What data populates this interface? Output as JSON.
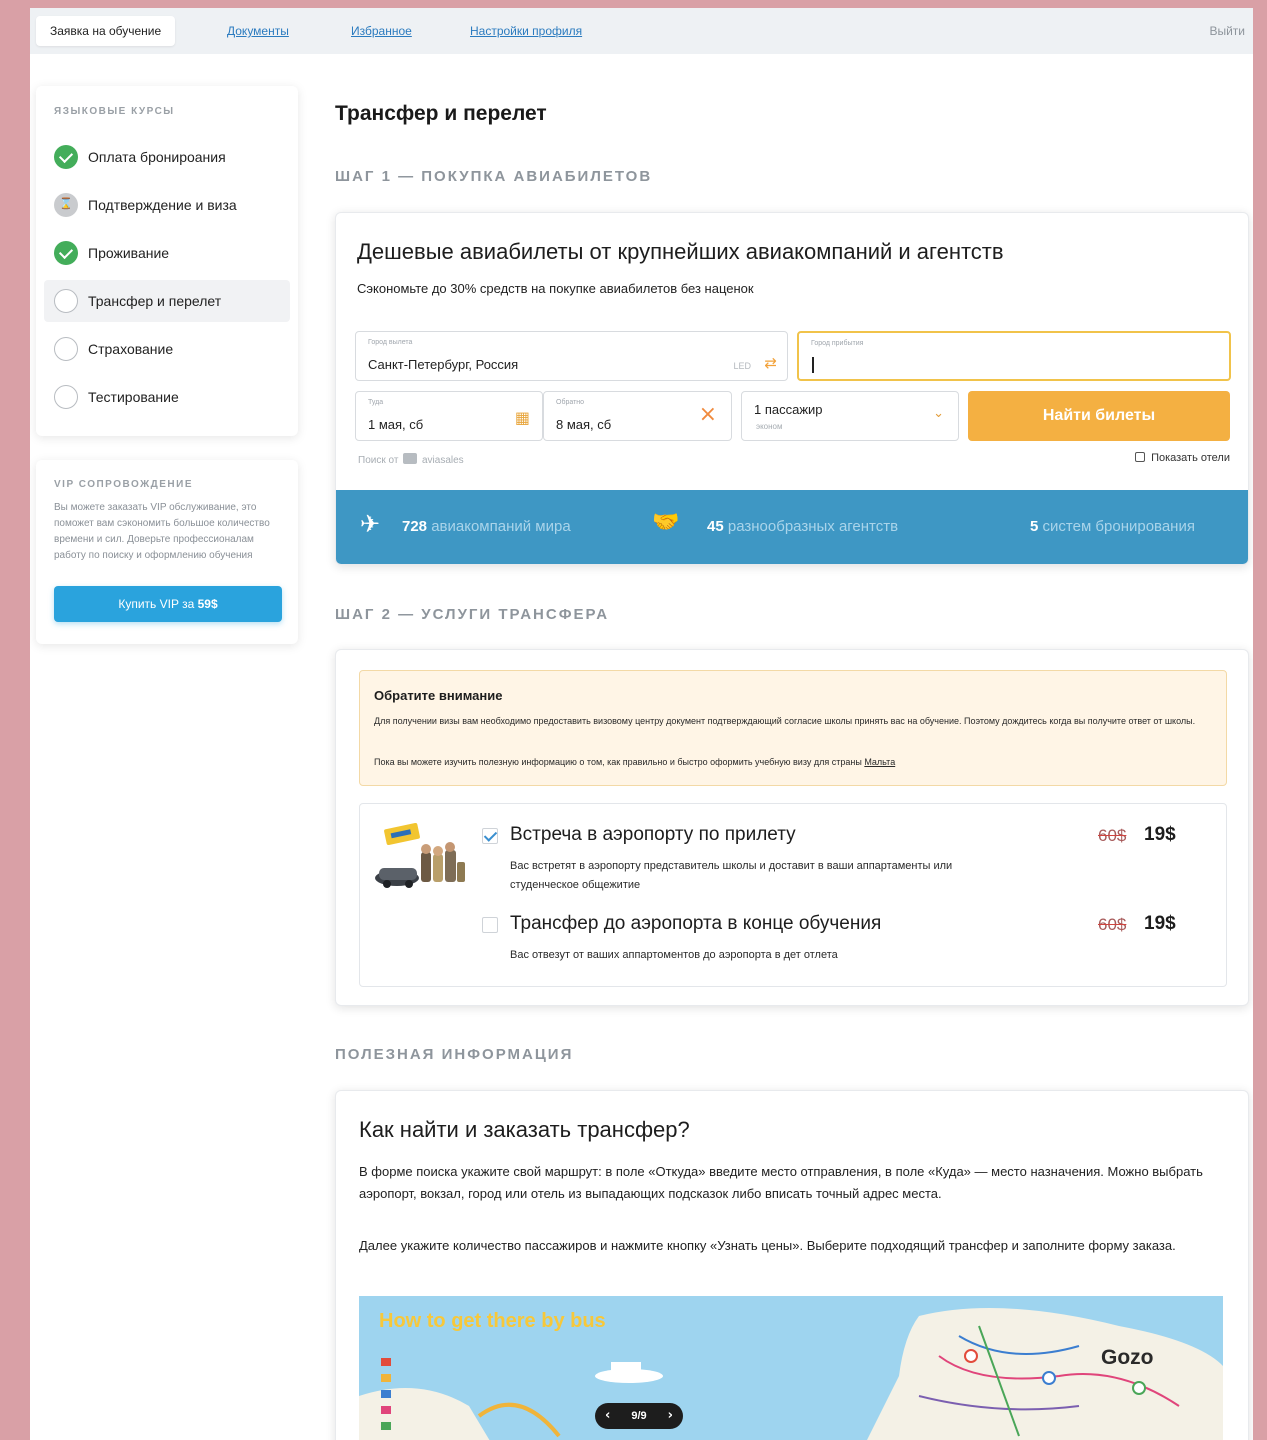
{
  "nav": {
    "active_tab": "Заявка на обучение",
    "links": [
      "Документы",
      "Избранное",
      "Настройки профиля"
    ],
    "logout": "Выйти"
  },
  "sidebar": {
    "heading": "ЯЗЫКОВЫЕ КУРСЫ",
    "steps": [
      {
        "label": "Оплата бронироания",
        "status": "done"
      },
      {
        "label": "Подтверждение и виза",
        "status": "pending"
      },
      {
        "label": "Проживание",
        "status": "done"
      },
      {
        "label": "Трансфер и перелет",
        "status": "current"
      },
      {
        "label": "Страхование",
        "status": "todo"
      },
      {
        "label": "Тестирование",
        "status": "todo"
      }
    ],
    "vip": {
      "heading": "VIP СОПРОВОЖДЕНИЕ",
      "text": "Вы можете заказать VIP обслуживание, это поможет вам сэкономить большое количество времени и сил. Доверьте профессионалам работу по поиску и оформлению обучения",
      "button_prefix": "Купить VIP за",
      "button_price": "59$"
    }
  },
  "main": {
    "title": "Трансфер и перелет",
    "step1_label": "ШАГ 1 — ПОКУПКА АВИАБИЛЕТОВ",
    "step2_label": "ШАГ 2 — УСЛУГИ ТРАНСФЕРА",
    "info_label": "ПОЛЕЗНАЯ ИНФОРМАЦИЯ"
  },
  "flights": {
    "title": "Дешевые авиабилеты от крупнейших авиакомпаний и агентств",
    "subtitle": "Сэкономьте до 30% средств на покупке авиабилетов без наценок",
    "from_label": "Город вылета",
    "from_value": "Санкт-Петербург, Россия",
    "from_iata": "LED",
    "to_label": "Город прибытия",
    "to_value": "",
    "depart_label": "Туда",
    "depart_value": "1 мая, сб",
    "return_label": "Обратно",
    "return_value": "8 мая, сб",
    "passengers_value": "1 пассажир",
    "class_value": "эконом",
    "search_button": "Найти билеты",
    "powered_by_prefix": "Поиск от",
    "powered_by_brand": "aviasales",
    "show_hotels": "Показать отели",
    "stats": [
      {
        "number": "728",
        "text": "авиакомпаний мира",
        "icon": "plane-icon"
      },
      {
        "number": "45",
        "text": "разнообразных агентств",
        "icon": "handshake-icon"
      },
      {
        "number": "5",
        "text": "систем бронирования",
        "icon": ""
      }
    ]
  },
  "transfer": {
    "notice_title": "Обратите внимание",
    "notice_text": "Для получении визы вам необходимо предоставить визовому центру документ подтверждающий согласие школы принять вас на обучение. Поэтому дождитесь когда вы получите ответ от школы.",
    "notice_text2_prefix": "Пока вы можете изучить полезную информацию о том, как правильно и быстро оформить учебную визу для страны",
    "notice_link": "Мальта",
    "services": [
      {
        "title": "Встреча в аэропорту по прилету",
        "desc": "Вас встретят в аэропорту представитель школы и доставит в ваши аппартаменты или студенческое общежитие",
        "old_price": "60$",
        "new_price": "19$",
        "checked": true
      },
      {
        "title": "Трансфер до аэропорта в конце обучения",
        "desc": "Вас отвезут от ваших аппартоментов до аэропорта в дет отлета",
        "old_price": "60$",
        "new_price": "19$",
        "checked": false
      }
    ]
  },
  "info": {
    "title": "Как найти и заказать трансфер?",
    "p1": "В форме поиска укажите свой маршрут: в поле «Откуда» введите место отправления, в поле «Куда» — место назначения. Можно выбрать аэропорт, вокзал, город или отель из выпадающих подсказок либо вписать точный адрес места.",
    "p2": "Далее укажите количество пассажиров и нажмите кнопку «Узнать цены». Выберите подходящий трансфер и заполните форму заказа.",
    "map_title": "How to get there by bus",
    "map_gozo": "Gozo",
    "pager": "9/9"
  },
  "colors": {
    "accent_blue": "#2aa3dd",
    "band_blue": "#3e97c4",
    "button_orange": "#f4b042",
    "success_green": "#43ad5a",
    "background_pink": "#d9a0a6"
  }
}
